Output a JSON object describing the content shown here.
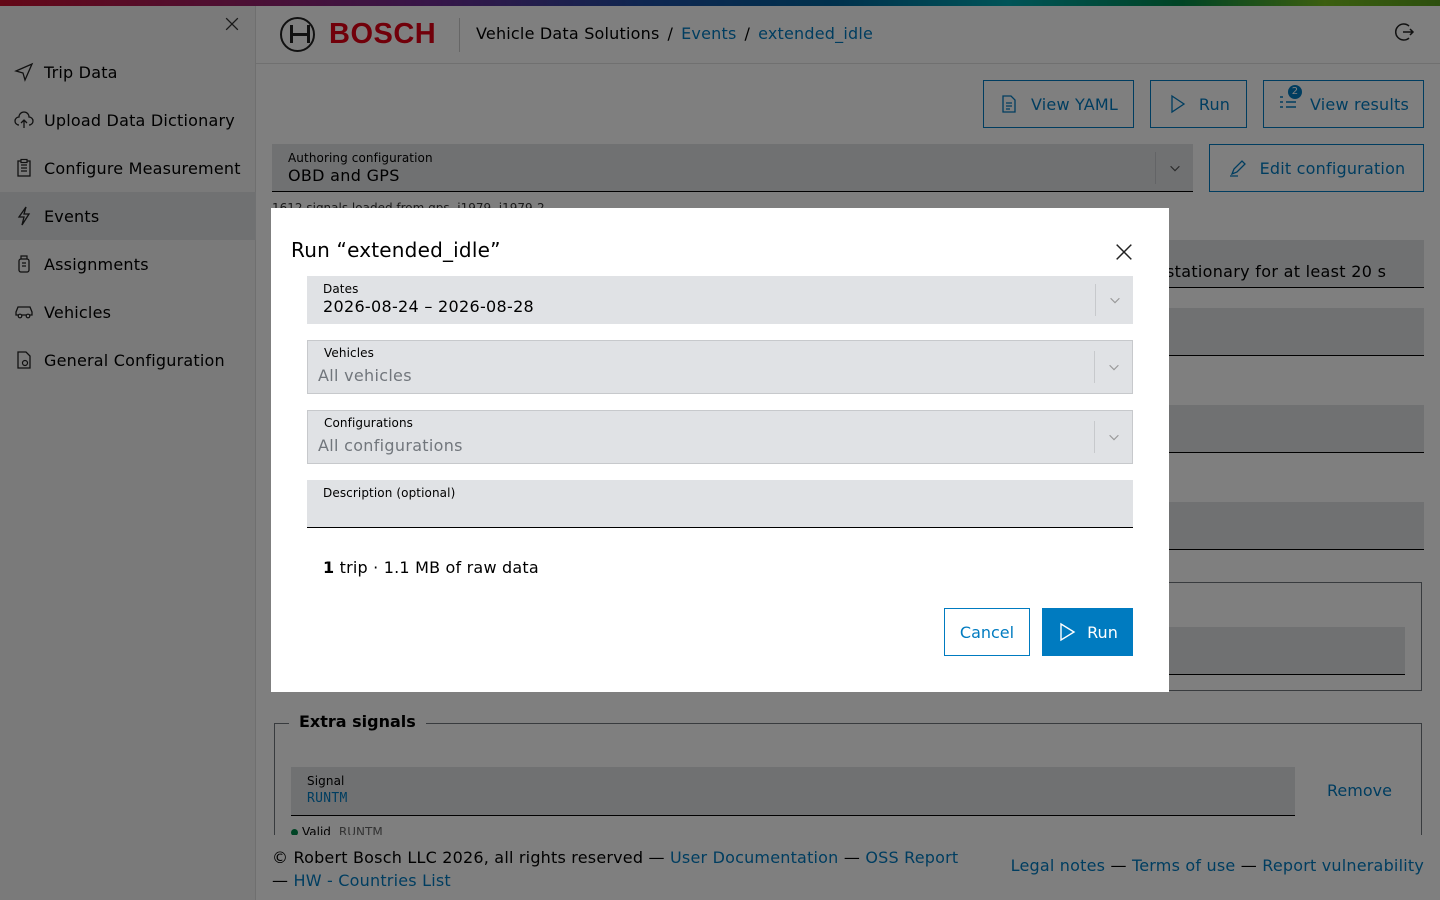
{
  "sidebar": {
    "close_icon": "close-icon",
    "items": [
      {
        "label": "Trip Data",
        "icon": "send-icon",
        "active": false
      },
      {
        "label": "Upload Data Dictionary",
        "icon": "cloud-upload-icon",
        "active": false
      },
      {
        "label": "Configure Measurement",
        "icon": "clipboard-icon",
        "active": false
      },
      {
        "label": "Events",
        "icon": "lightning-icon",
        "active": true
      },
      {
        "label": "Assignments",
        "icon": "device-icon",
        "active": false
      },
      {
        "label": "Vehicles",
        "icon": "car-icon",
        "active": false
      },
      {
        "label": "General Configuration",
        "icon": "document-settings-icon",
        "active": false
      }
    ]
  },
  "header": {
    "brand": "BOSCH",
    "breadcrumb": {
      "root": "Vehicle Data Solutions",
      "sep": "/",
      "events": "Events",
      "current": "extended_idle"
    }
  },
  "toolbar": {
    "view_yaml": "View YAML",
    "run": "Run",
    "view_results": "View results",
    "results_count": "2",
    "edit_configuration": "Edit configuration"
  },
  "authoring": {
    "label": "Authoring configuration",
    "value": "OBD and GPS",
    "hint": "1612 signals loaded from gps, j1979, j1979-2"
  },
  "background": {
    "condition_text": "stationary for at least 20 s"
  },
  "extra_signals": {
    "legend": "Extra signals",
    "signal_label": "Signal",
    "signal_value": "RUNTM",
    "remove": "Remove",
    "valid_label": "Valid",
    "valid_value": "RUNTM"
  },
  "footer": {
    "copyright": "© Robert Bosch LLC 2026, all rights reserved",
    "dash": "—",
    "user_docs": "User Documentation",
    "oss_report": "OSS Report",
    "hw_countries": "HW - Countries List",
    "legal_notes": "Legal notes",
    "terms": "Terms of use",
    "report_vuln": "Report vulnerability"
  },
  "dialog": {
    "title": "Run “extended_idle”",
    "dates_label": "Dates",
    "dates_value": "2026-08-24 – 2026-08-28",
    "vehicles_label": "Vehicles",
    "vehicles_placeholder": "All vehicles",
    "configurations_label": "Configurations",
    "configurations_placeholder": "All configurations",
    "description_label": "Description (optional)",
    "summary_count": "1",
    "summary_text": "trip · 1.1 MB of raw data",
    "cancel": "Cancel",
    "run": "Run"
  },
  "colors": {
    "accent": "#007bc0",
    "brand_red": "#e20015",
    "valid_green": "#00884a"
  }
}
